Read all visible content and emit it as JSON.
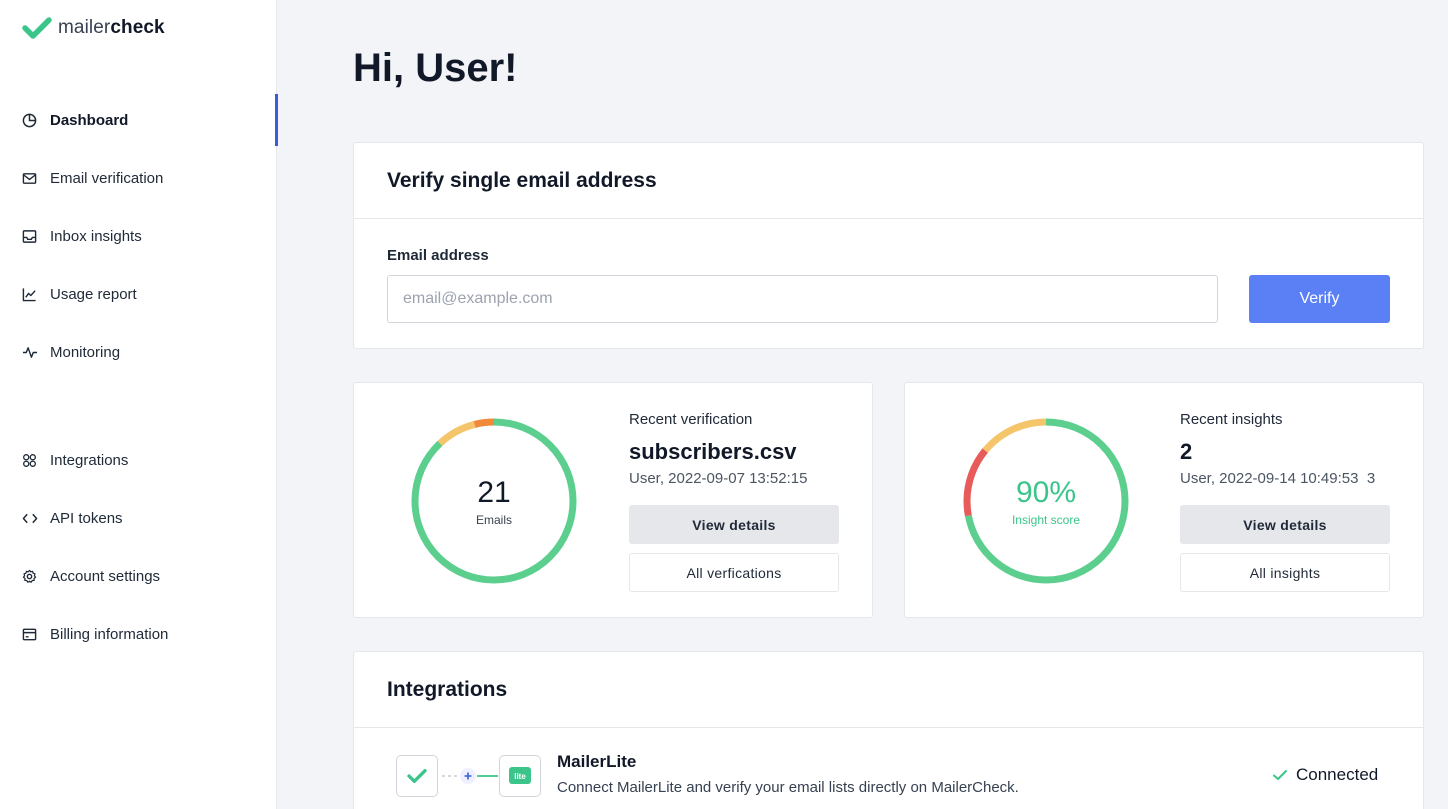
{
  "brand": {
    "name_light": "mailer",
    "name_bold": "check",
    "accent": "#3cc58a"
  },
  "sidebar": {
    "items": [
      {
        "label": "Dashboard",
        "icon": "pie-chart-icon",
        "active": true
      },
      {
        "label": "Email verification",
        "icon": "mail-check-icon"
      },
      {
        "label": "Inbox insights",
        "icon": "inbox-icon"
      },
      {
        "label": "Usage report",
        "icon": "line-chart-icon"
      },
      {
        "label": "Monitoring",
        "icon": "activity-icon"
      },
      {
        "label": "Integrations",
        "icon": "grid-icon"
      },
      {
        "label": "API tokens",
        "icon": "code-icon"
      },
      {
        "label": "Account settings",
        "icon": "gear-icon"
      },
      {
        "label": "Billing information",
        "icon": "credit-card-icon"
      }
    ]
  },
  "greeting": "Hi, User!",
  "verify": {
    "title": "Verify single email address",
    "field_label": "Email address",
    "placeholder": "email@example.com",
    "button": "Verify",
    "button_color": "#5b7ff5"
  },
  "recent_verification": {
    "label": "Recent verification",
    "title": "subscribers.csv",
    "meta": "User, 2022-09-07 13:52:15",
    "count": "21",
    "count_caption": "Emails",
    "view_button": "View details",
    "all_button": "All verfications",
    "ring_segments": [
      {
        "status": "valid",
        "color": "#5ccf8f",
        "fraction": 0.88
      },
      {
        "status": "risky",
        "color": "#f5c56b",
        "fraction": 0.08
      },
      {
        "status": "invalid",
        "color": "#f08a3a",
        "fraction": 0.04
      }
    ]
  },
  "recent_insights": {
    "label": "Recent insights",
    "title": "2",
    "meta": "User, 2022-09-14 10:49:53",
    "meta_suffix": "3",
    "score": "90%",
    "score_caption": "Insight score",
    "view_button": "View details",
    "all_button": "All insights",
    "ring_segments": [
      {
        "status": "good",
        "color": "#5ccf8f",
        "fraction": 0.72
      },
      {
        "status": "bad",
        "color": "#e85b5b",
        "fraction": 0.14
      },
      {
        "status": "warning",
        "color": "#f5c56b",
        "fraction": 0.14
      }
    ]
  },
  "integrations": {
    "title": "Integrations",
    "items": [
      {
        "name": "MailerLite",
        "description": "Connect MailerLite and verify your email lists directly on MailerCheck.",
        "badge": "lite",
        "status": "Connected"
      }
    ]
  }
}
